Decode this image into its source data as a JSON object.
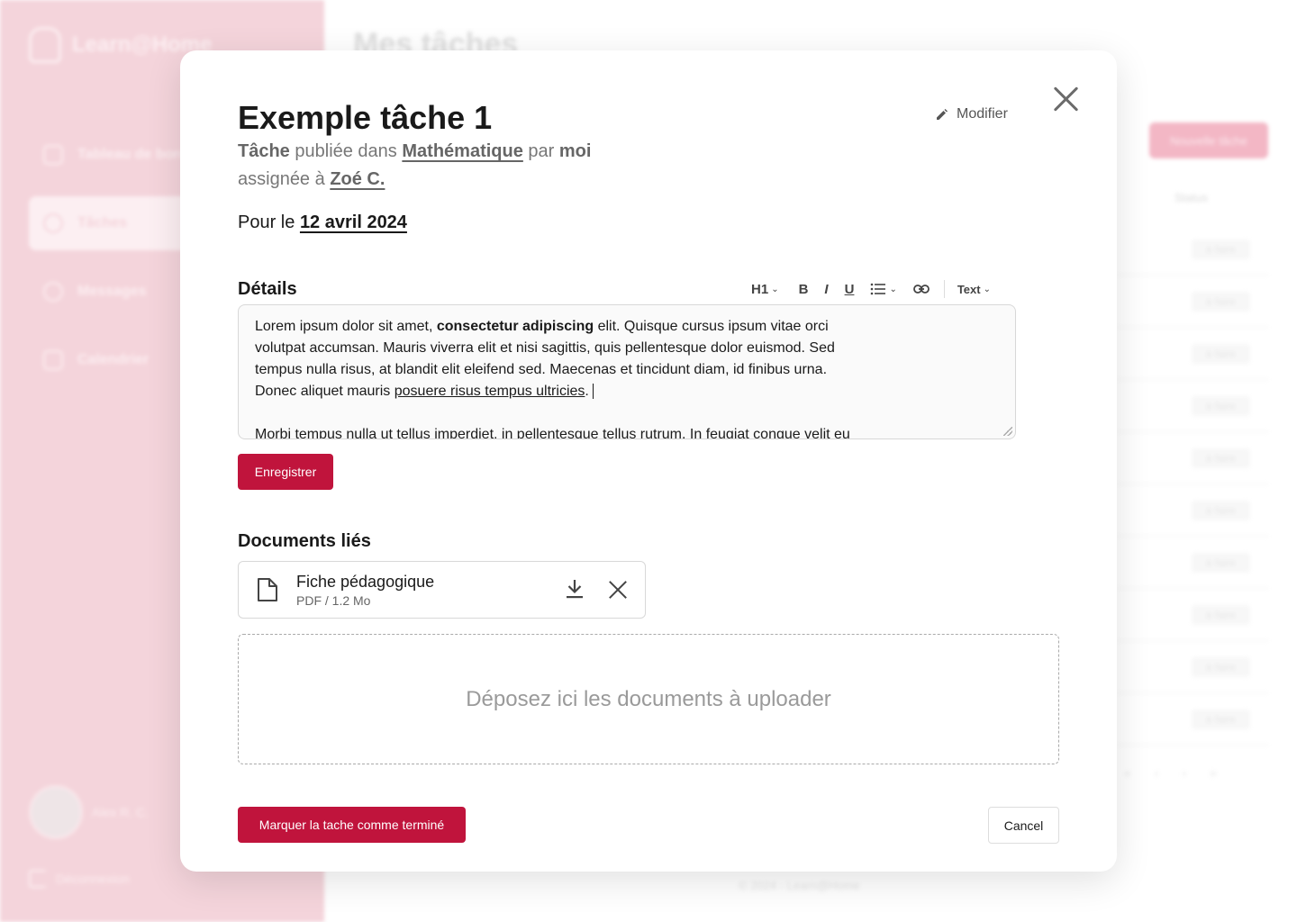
{
  "background": {
    "app_name": "Learn@Home",
    "page_title": "Mes tâches",
    "nav": [
      {
        "label": "Tableau de bord"
      },
      {
        "label": "Tâches"
      },
      {
        "label": "Messages"
      },
      {
        "label": "Calendrier"
      }
    ],
    "user_name": "Alex R. C.",
    "logout": "Déconnexion",
    "new_task_label": "Nouvelle tâche",
    "status_header": "Status",
    "row_status": "à faire",
    "footer": "© 2024 - Learn@Home"
  },
  "modal": {
    "title": "Exemple tâche 1",
    "modify_label": "Modifier",
    "meta": {
      "task_word": "Tâche",
      "published_in": "publiée dans",
      "subject": "Mathématique",
      "by": "par",
      "author": "moi",
      "assigned_to": "assignée à",
      "assignee": "Zoé C."
    },
    "due": {
      "prefix": "Pour le",
      "date": "12 avril 2024"
    },
    "details": {
      "label": "Détails",
      "toolbar": {
        "heading": "H1",
        "bold": "B",
        "italic": "I",
        "underline": "U",
        "text_style": "Text"
      },
      "content": {
        "p1_a": "Lorem ipsum dolor sit amet, ",
        "p1_bold": "consectetur adipiscing",
        "p1_b": " elit. Quisque cursus ipsum vitae orci",
        "p1_line2": "volutpat accumsan. Mauris viverra elit et nisi sagittis, quis pellentesque dolor euismod. Sed",
        "p1_line3": "tempus nulla risus, at blandit elit eleifend sed. Maecenas et tincidunt diam, id finibus urna.",
        "p1_line4_a": "Donec aliquet mauris ",
        "p1_line4_u": "posuere risus tempus ultricies",
        "p1_line4_b": ".",
        "p2": "Morbi tempus nulla ut tellus imperdiet, in pellentesque tellus rutrum. In feugiat congue velit eu"
      },
      "save_label": "Enregistrer"
    },
    "documents": {
      "label": "Documents liés",
      "files": [
        {
          "name": "Fiche pédagogique",
          "meta": "PDF / 1.2 Mo"
        }
      ],
      "dropzone": "Déposez ici les documents à uploader"
    },
    "complete_label": "Marquer la tache comme terminé",
    "cancel_label": "Cancel"
  },
  "colors": {
    "accent": "#c0143c",
    "sidebar": "#f1c6cf"
  }
}
